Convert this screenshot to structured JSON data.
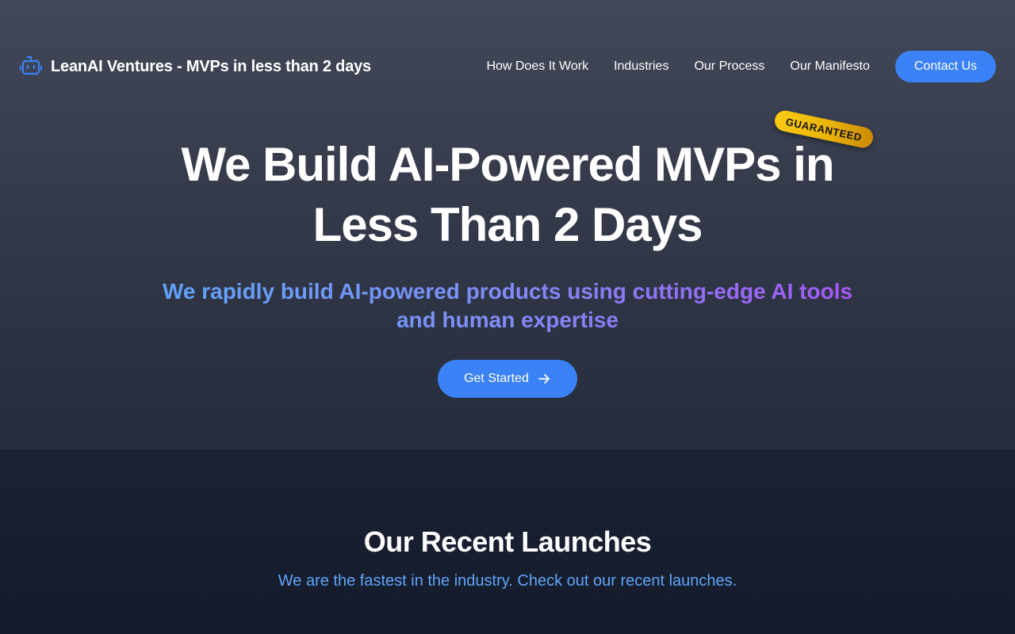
{
  "brand": {
    "title": "LeanAI Ventures - MVPs in less than 2 days",
    "icon": "robot-icon"
  },
  "nav": {
    "links": [
      "How Does It Work",
      "Industries",
      "Our Process",
      "Our Manifesto"
    ],
    "contact_label": "Contact Us"
  },
  "hero": {
    "headline_line1": "We Build AI-Powered MVPs in",
    "headline_line2": "Less Than 2 Days",
    "badge": "GUARANTEED",
    "subheadline": "We rapidly build AI-powered products using cutting-edge AI tools and human expertise",
    "cta_label": "Get Started",
    "cta_icon": "arrow-right-icon"
  },
  "launches": {
    "title": "Our Recent Launches",
    "subtitle": "We are the fastest in the industry. Check out our recent launches."
  },
  "colors": {
    "accent": "#3b82f6",
    "badge": "#facc15",
    "gradient_start": "#60a5fa",
    "gradient_end": "#a855f7"
  }
}
